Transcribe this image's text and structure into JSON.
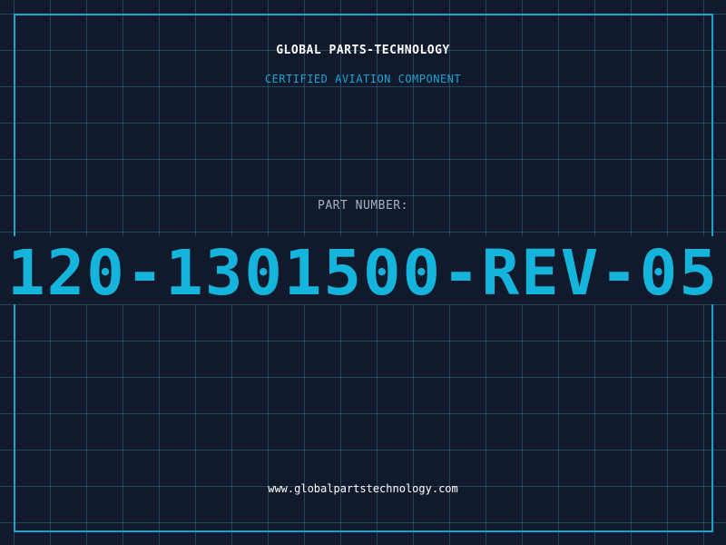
{
  "header": {
    "company": "GLOBAL PARTS-TECHNOLOGY",
    "subtitle": "CERTIFIED AVIATION COMPONENT"
  },
  "part": {
    "label": "PART NUMBER:",
    "number": "120-1301500-REV-05"
  },
  "footer": {
    "website": "www.globalpartstechnology.com"
  },
  "colors": {
    "background": "#111a2c",
    "accent": "#14b4dc",
    "grid": "#3c7896",
    "frame": "#18a6cf",
    "label": "#a7b3c6"
  }
}
